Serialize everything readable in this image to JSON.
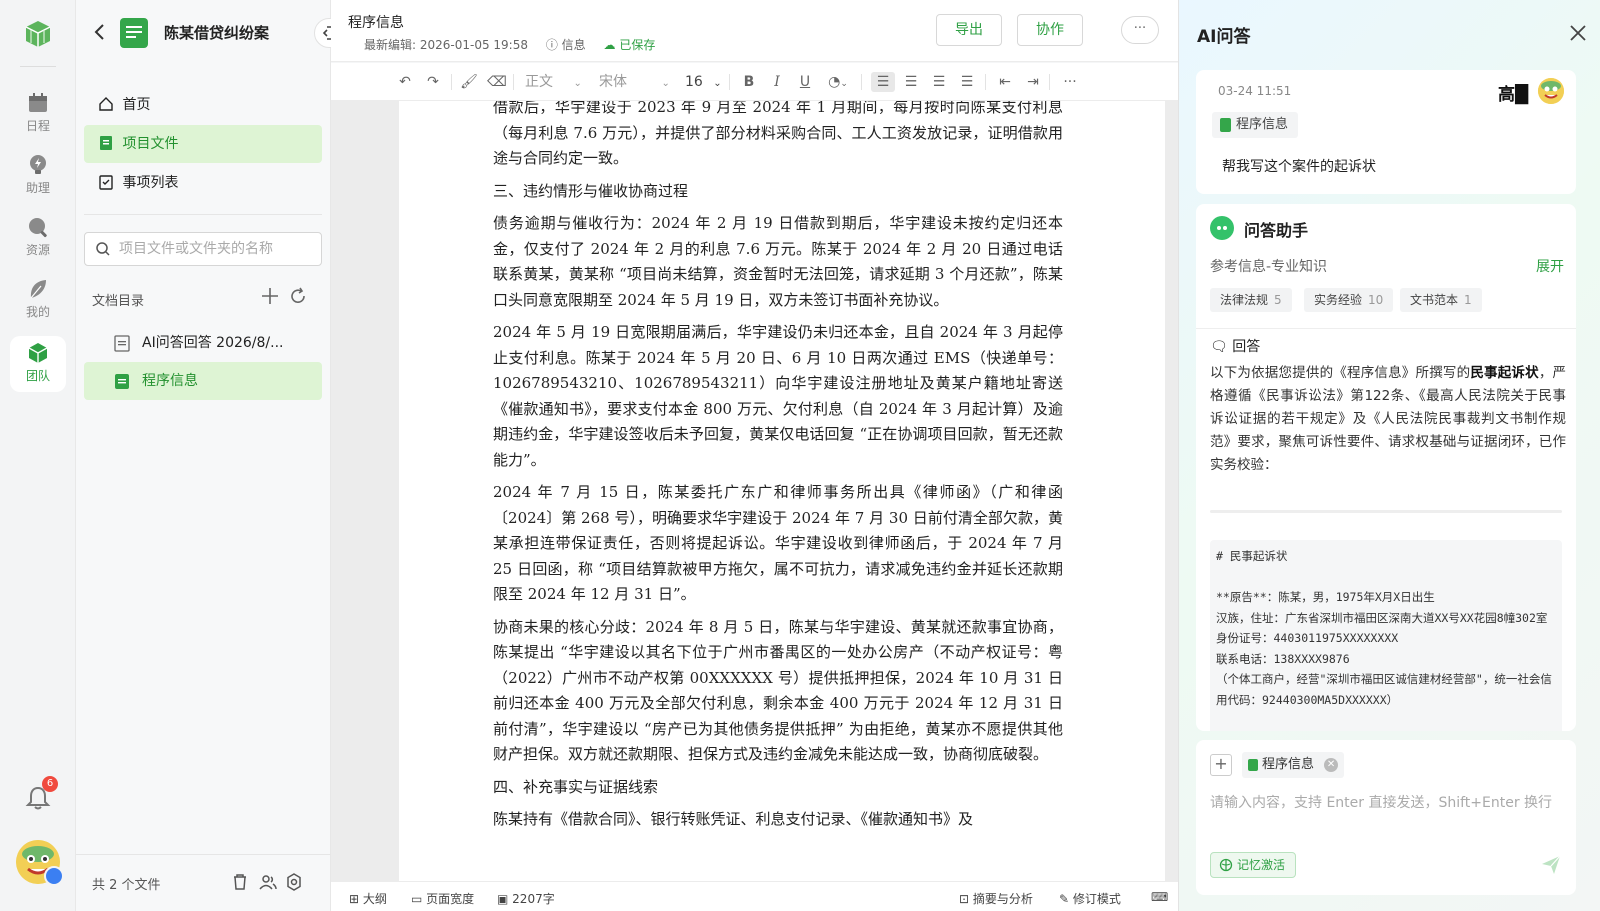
{
  "rail": {
    "items": [
      {
        "label": "日程",
        "icon": "calendar-icon"
      },
      {
        "label": "助理",
        "icon": "bulb-icon"
      },
      {
        "label": "资源",
        "icon": "search-icon"
      },
      {
        "label": "我的",
        "icon": "feather-icon"
      },
      {
        "label": "团队",
        "icon": "cube-icon"
      }
    ],
    "active": "团队",
    "notification_count": "6"
  },
  "sidebar": {
    "project_title": "陈某借贷纠纷案",
    "nav": [
      {
        "label": "首页",
        "icon": "home-icon"
      },
      {
        "label": "项目文件",
        "icon": "file-icon"
      },
      {
        "label": "事项列表",
        "icon": "checklist-icon"
      }
    ],
    "search_placeholder": "项目文件或文件夹的名称",
    "dir_label": "文档目录",
    "files": [
      {
        "label": "AI问答回答 2026/8/...",
        "icon": "doc-outline-icon"
      },
      {
        "label": "程序信息",
        "icon": "doc-green-icon"
      }
    ],
    "file_count": "共 2 个文件"
  },
  "doc": {
    "title": "程序信息",
    "last_edit": "最新编辑: 2026-01-05 19:58",
    "info": "信息",
    "saved": "已保存",
    "export": "导出",
    "collab": "协作",
    "more": "···"
  },
  "toolbar": {
    "style": "正文",
    "font": "宋体",
    "size": "16",
    "bold": "B",
    "italic": "I",
    "underline": "U",
    "more": "···"
  },
  "page": {
    "paragraphs": [
      "借款后，华宇建设于 2023 年 9 月至 2024 年 1 月期间，每月按时向陈某支付利息（每月利息 7.6 万元），并提供了部分材料采购合同、工人工资发放记录，证明借款用途与合同约定一致。",
      "三、违约情形与催收协商过程",
      "债务逾期与催收行为：2024 年 2 月 19 日借款到期后，华宇建设未按约定归还本金，仅支付了 2024 年 2 月的利息 7.6 万元。陈某于 2024 年 2 月 20 日通过电话联系黄某，黄某称 “项目尚未结算，资金暂时无法回笼，请求延期 3 个月还款”，陈某口头同意宽限期至 2024 年 5 月 19 日，双方未签订书面补充协议。",
      "2024 年 5 月 19 日宽限期届满后，华宇建设仍未归还本金，且自 2024 年 3 月起停止支付利息。陈某于 2024 年 5 月 20 日、6 月 10 日两次通过 EMS（快递单号：1026789543210、1026789543211）向华宇建设注册地址及黄某户籍地址寄送《催款通知书》，要求支付本金 800 万元、欠付利息（自 2024 年 3 月起计算）及逾期违约金，华宇建设签收后未予回复，黄某仅电话回复 “正在协调项目回款，暂无还款能力”。",
      "2024 年 7 月 15 日，陈某委托广东广和律师事务所出具《律师函》（广和律函〔2024〕第 268 号），明确要求华宇建设于 2024 年 7 月 30 日前付清全部欠款，黄某承担连带保证责任，否则将提起诉讼。华宇建设收到律师函后，于 2024 年 7 月 25 日回函，称 “项目结算款被甲方拖欠，属不可抗力，请求减免违约金并延长还款期限至 2024 年 12 月 31 日”。",
      "协商未果的核心分歧：2024 年 8 月 5 日，陈某与华宇建设、黄某就还款事宜协商，陈某提出 “华宇建设以其名下位于广州市番禺区的一处办公房产（不动产权证号：粤（2022）广州市不动产权第 00XXXXXX 号）提供抵押担保，2024 年 10 月 31 日前归还本金 400 万元及全部欠付利息，剩余本金 400 万元于 2024 年 12 月 31 日前付清”，华宇建设以 “房产已为其他债务提供抵押” 为由拒绝，黄某亦不愿提供其他财产担保。双方就还款期限、担保方式及违约金减免未能达成一致，协商彻底破裂。",
      "四、补充事实与证据线索",
      "陈某持有《借款合同》、银行转账凭证、利息支付记录、《催款通知书》及"
    ]
  },
  "status": {
    "outline": "大纲",
    "page_width": "页面宽度",
    "word_count": "2207字",
    "summary": "摘要与分析",
    "revision": "修订模式"
  },
  "ai": {
    "title": "AI问答",
    "question": {
      "time": "03-24 11:51",
      "user": "高█",
      "tag": "程序信息",
      "text": "帮我写这个案件的起诉状"
    },
    "answer": {
      "assistant_name": "问答助手",
      "ref_title": "参考信息-专业知识",
      "expand": "展开",
      "chips": [
        {
          "label": "法律法规",
          "count": "5"
        },
        {
          "label": "实务经验",
          "count": "10"
        },
        {
          "label": "文书范本",
          "count": "1"
        }
      ],
      "label": "回答",
      "intro_pre": "以下为依据您提供的《程序信息》所撰写的",
      "intro_bold": "民事起诉状",
      "intro_post": "，严格遵循《民事诉讼法》第122条、《最高人民法院关于民事诉讼证据的若干规定》及《人民法院民事裁判文书制作规范》要求，聚焦可诉性要件、请求权基础与证据闭环，已作实务校验：",
      "code_lines": [
        "# 民事起诉状",
        "",
        "**原告**：陈某，男，1975年X月X日出生",
        "汉族，住址：广东省深圳市福田区深南大道XX号XX花园8幢302室",
        "身份证号：4403011975XXXXXXXX",
        "联系电话：138XXXX9876",
        "（个体工商户，经营\"深圳市福田区诚信建材经营部\"，统一社会信用代码：92440300MA5DXXXXXX）"
      ]
    },
    "input": {
      "tag": "程序信息",
      "placeholder": "请输入内容，支持 Enter 直接发送，Shift+Enter 换行",
      "memory": "记忆激活"
    }
  },
  "colors": {
    "accent": "#2fa044",
    "active_bg": "#def4d4"
  }
}
